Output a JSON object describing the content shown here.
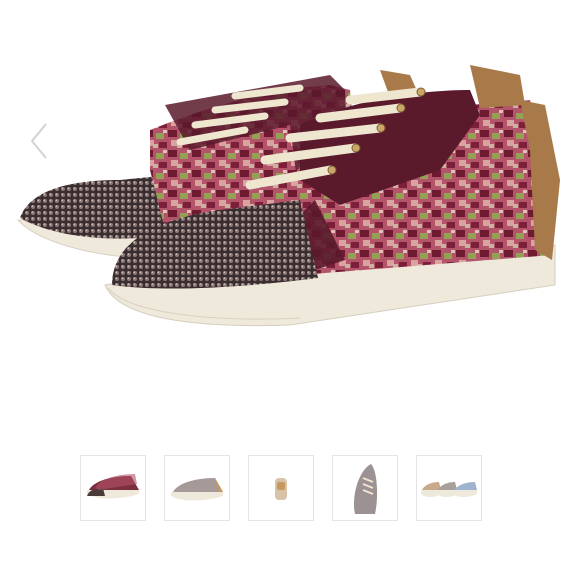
{
  "viewer": {
    "prev_icon": "chevron-left-icon",
    "main_image": "sneaker-pair-photo",
    "colors": {
      "upper_burgundy": "#5a1a2c",
      "pattern_pink": "#c77a83",
      "pattern_green": "#8a9a4a",
      "crystal_toe": "#4b3a3a",
      "sole_cream": "#efe9dc",
      "lace_cream": "#eee6cf",
      "heel_bronze": "#a87a4a"
    }
  },
  "thumbnails": [
    {
      "name": "thumb-pair-side",
      "selected": true
    },
    {
      "name": "thumb-single-side",
      "selected": false
    },
    {
      "name": "thumb-back",
      "selected": false
    },
    {
      "name": "thumb-top",
      "selected": false
    },
    {
      "name": "thumb-color-variants",
      "selected": false
    }
  ]
}
